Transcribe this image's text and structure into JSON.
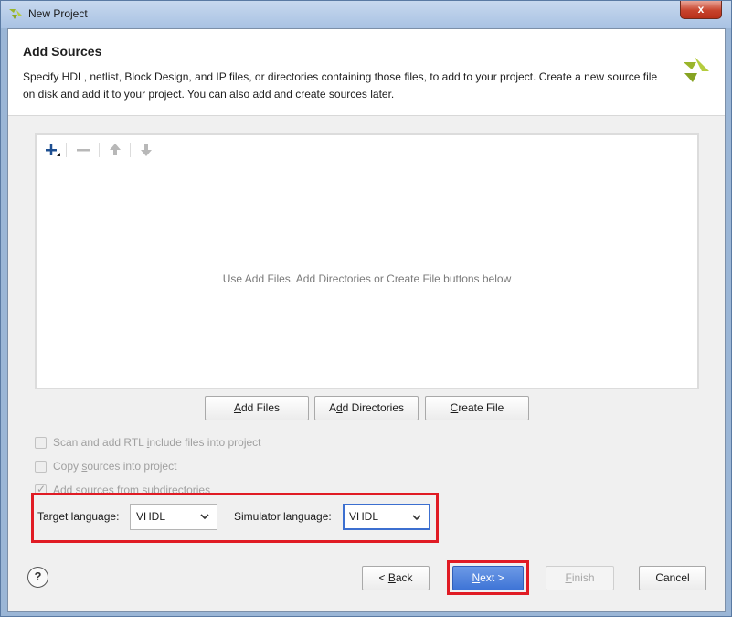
{
  "window": {
    "title": "New Project",
    "close_label": "x"
  },
  "header": {
    "title": "Add Sources",
    "description": "Specify HDL, netlist, Block Design, and IP files, or directories containing those files, to add to your project. Create a new source file on disk and add it to your project. You can also add and create sources later."
  },
  "toolbar": {
    "icons": [
      "add-icon",
      "remove-icon",
      "move-up-icon",
      "move-down-icon"
    ]
  },
  "sources": {
    "empty_message": "Use Add Files, Add Directories or Create File buttons below"
  },
  "actions": {
    "add_files_mnemonic": "A",
    "add_files_rest": "dd Files",
    "add_dirs_pre": "A",
    "add_dirs_mnemonic": "d",
    "add_dirs_rest": "d Directories",
    "create_file_mnemonic": "C",
    "create_file_rest": "reate File"
  },
  "options": [
    {
      "pre": "Scan and add RTL ",
      "mnemonic": "i",
      "post": "nclude files into project",
      "checked": false
    },
    {
      "pre": "Copy ",
      "mnemonic": "s",
      "post": "ources into project",
      "checked": false
    },
    {
      "pre": "Add sources from subdirectories",
      "mnemonic": "",
      "post": "",
      "checked": true
    }
  ],
  "languages": {
    "target_label": "Target language:",
    "target_value": "VHDL",
    "simulator_label": "Simulator language:",
    "simulator_value": "VHDL"
  },
  "footer": {
    "help_label": "?",
    "back_pre": "< ",
    "back_mnemonic": "B",
    "back_rest": "ack",
    "next_mnemonic": "N",
    "next_rest": "ext >",
    "finish_mnemonic": "F",
    "finish_rest": "inish",
    "cancel_label": "Cancel"
  },
  "colors": {
    "highlight": "#e01b24",
    "accent": "#3e74d6",
    "logo": "#9ab52b"
  }
}
